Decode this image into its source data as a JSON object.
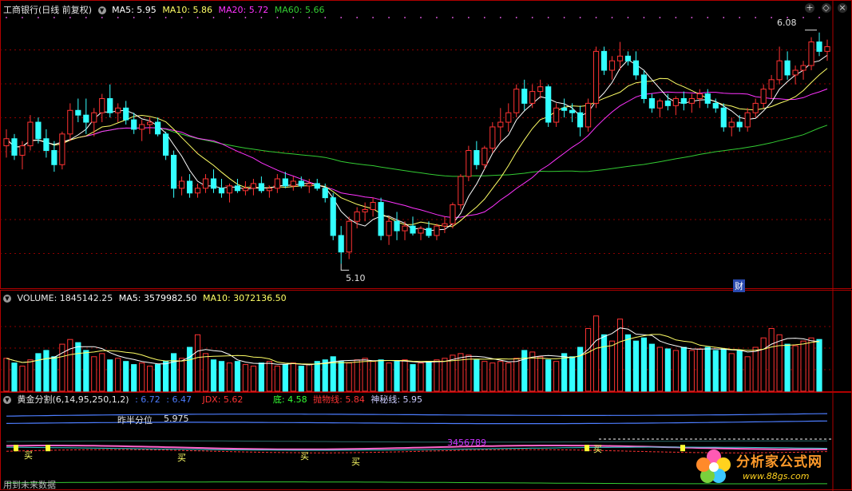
{
  "header": {
    "title": "工商银行(日线 前复权)",
    "ma5": "MA5: 5.95",
    "ma10": "MA10: 5.86",
    "ma20": "MA20: 5.72",
    "ma60": "MA60: 5.66"
  },
  "volume_header": {
    "title": "VOLUME: 1845142.25",
    "ma5": "MA5: 3579982.50",
    "ma10": "MA10: 3072136.50"
  },
  "indicator_header": {
    "title": "黄金分割(6,14,95,250,1,2)",
    "v1": ": 6.72",
    "v2": ": 6.47",
    "jdx": "JDX: 5.62",
    "di": "底: 4.58",
    "pwx": "抛物线: 5.84",
    "smx": "神秘线: 5.95"
  },
  "annotations": {
    "high": "6.08",
    "low": "5.10",
    "cai": "财",
    "half_label": "昨半分位",
    "half_value": "5.975",
    "buy": "买",
    "seq": "3456789",
    "future": "用到未来数据"
  },
  "window_buttons": {
    "add": "+",
    "restore": "◇",
    "close": "×"
  },
  "logo": {
    "text": "分析家公式网",
    "url": "www.88gs.com"
  },
  "colors": {
    "up": "#ff3333",
    "down": "#33ffff",
    "ma5": "#ffffff",
    "ma10": "#ffff66",
    "ma20": "#ff33ff",
    "ma60": "#33cc33",
    "grid": "#8b0000"
  },
  "chart_data": {
    "type": "candlestick",
    "price_ylim": [
      5.0,
      6.15
    ],
    "high_marker": 6.08,
    "low_marker": 5.1,
    "ohlc": [
      [
        5.6,
        5.67,
        5.55,
        5.63
      ],
      [
        5.63,
        5.65,
        5.54,
        5.56
      ],
      [
        5.56,
        5.62,
        5.5,
        5.6
      ],
      [
        5.6,
        5.73,
        5.58,
        5.7
      ],
      [
        5.7,
        5.72,
        5.61,
        5.63
      ],
      [
        5.63,
        5.67,
        5.55,
        5.58
      ],
      [
        5.58,
        5.62,
        5.49,
        5.52
      ],
      [
        5.52,
        5.66,
        5.5,
        5.65
      ],
      [
        5.65,
        5.78,
        5.62,
        5.75
      ],
      [
        5.75,
        5.8,
        5.7,
        5.73
      ],
      [
        5.73,
        5.8,
        5.65,
        5.7
      ],
      [
        5.7,
        5.76,
        5.64,
        5.74
      ],
      [
        5.74,
        5.82,
        5.7,
        5.8
      ],
      [
        5.8,
        5.86,
        5.72,
        5.74
      ],
      [
        5.74,
        5.78,
        5.7,
        5.76
      ],
      [
        5.76,
        5.79,
        5.69,
        5.71
      ],
      [
        5.71,
        5.74,
        5.65,
        5.67
      ],
      [
        5.67,
        5.71,
        5.62,
        5.69
      ],
      [
        5.69,
        5.72,
        5.65,
        5.7
      ],
      [
        5.7,
        5.72,
        5.64,
        5.65
      ],
      [
        5.65,
        5.66,
        5.54,
        5.56
      ],
      [
        5.56,
        5.58,
        5.38,
        5.42
      ],
      [
        5.42,
        5.47,
        5.39,
        5.45
      ],
      [
        5.45,
        5.48,
        5.38,
        5.4
      ],
      [
        5.4,
        5.44,
        5.38,
        5.42
      ],
      [
        5.42,
        5.48,
        5.4,
        5.46
      ],
      [
        5.46,
        5.5,
        5.4,
        5.42
      ],
      [
        5.42,
        5.46,
        5.38,
        5.4
      ],
      [
        5.4,
        5.44,
        5.36,
        5.43
      ],
      [
        5.43,
        5.46,
        5.4,
        5.41
      ],
      [
        5.41,
        5.45,
        5.39,
        5.42
      ],
      [
        5.42,
        5.46,
        5.39,
        5.44
      ],
      [
        5.44,
        5.47,
        5.4,
        5.41
      ],
      [
        5.41,
        5.43,
        5.38,
        5.42
      ],
      [
        5.42,
        5.48,
        5.4,
        5.46
      ],
      [
        5.46,
        5.49,
        5.42,
        5.43
      ],
      [
        5.43,
        5.47,
        5.41,
        5.45
      ],
      [
        5.45,
        5.47,
        5.42,
        5.43
      ],
      [
        5.43,
        5.46,
        5.4,
        5.44
      ],
      [
        5.44,
        5.46,
        5.41,
        5.42
      ],
      [
        5.42,
        5.44,
        5.36,
        5.38
      ],
      [
        5.38,
        5.4,
        5.2,
        5.22
      ],
      [
        5.22,
        5.26,
        5.1,
        5.15
      ],
      [
        5.15,
        5.3,
        5.12,
        5.28
      ],
      [
        5.28,
        5.34,
        5.25,
        5.32
      ],
      [
        5.32,
        5.36,
        5.28,
        5.33
      ],
      [
        5.33,
        5.38,
        5.3,
        5.36
      ],
      [
        5.36,
        5.38,
        5.2,
        5.22
      ],
      [
        5.22,
        5.3,
        5.18,
        5.28
      ],
      [
        5.28,
        5.32,
        5.2,
        5.24
      ],
      [
        5.24,
        5.28,
        5.2,
        5.26
      ],
      [
        5.26,
        5.3,
        5.22,
        5.23
      ],
      [
        5.23,
        5.26,
        5.2,
        5.25
      ],
      [
        5.25,
        5.28,
        5.21,
        5.22
      ],
      [
        5.22,
        5.27,
        5.2,
        5.26
      ],
      [
        5.26,
        5.3,
        5.23,
        5.27
      ],
      [
        5.27,
        5.36,
        5.25,
        5.35
      ],
      [
        5.35,
        5.48,
        5.33,
        5.47
      ],
      [
        5.47,
        5.6,
        5.45,
        5.58
      ],
      [
        5.58,
        5.62,
        5.5,
        5.52
      ],
      [
        5.52,
        5.6,
        5.5,
        5.59
      ],
      [
        5.59,
        5.7,
        5.57,
        5.68
      ],
      [
        5.68,
        5.76,
        5.62,
        5.7
      ],
      [
        5.7,
        5.78,
        5.66,
        5.74
      ],
      [
        5.74,
        5.86,
        5.72,
        5.84
      ],
      [
        5.84,
        5.88,
        5.75,
        5.78
      ],
      [
        5.78,
        5.86,
        5.76,
        5.83
      ],
      [
        5.83,
        5.88,
        5.8,
        5.85
      ],
      [
        5.85,
        5.86,
        5.68,
        5.7
      ],
      [
        5.7,
        5.78,
        5.68,
        5.76
      ],
      [
        5.76,
        5.8,
        5.72,
        5.75
      ],
      [
        5.75,
        5.78,
        5.7,
        5.74
      ],
      [
        5.74,
        5.77,
        5.64,
        5.68
      ],
      [
        5.68,
        5.8,
        5.66,
        5.78
      ],
      [
        5.78,
        6.02,
        5.76,
        6.0
      ],
      [
        6.0,
        6.02,
        5.9,
        5.92
      ],
      [
        5.92,
        5.98,
        5.88,
        5.96
      ],
      [
        5.96,
        6.04,
        5.92,
        5.98
      ],
      [
        5.98,
        6.0,
        5.94,
        5.96
      ],
      [
        5.96,
        6.0,
        5.88,
        5.9
      ],
      [
        5.9,
        5.92,
        5.78,
        5.8
      ],
      [
        5.8,
        5.82,
        5.74,
        5.76
      ],
      [
        5.76,
        5.8,
        5.72,
        5.79
      ],
      [
        5.79,
        5.82,
        5.75,
        5.77
      ],
      [
        5.77,
        5.81,
        5.73,
        5.8
      ],
      [
        5.8,
        5.83,
        5.75,
        5.78
      ],
      [
        5.78,
        5.82,
        5.74,
        5.8
      ],
      [
        5.8,
        5.84,
        5.76,
        5.82
      ],
      [
        5.82,
        5.84,
        5.76,
        5.78
      ],
      [
        5.78,
        5.8,
        5.74,
        5.76
      ],
      [
        5.76,
        5.78,
        5.66,
        5.68
      ],
      [
        5.68,
        5.72,
        5.64,
        5.7
      ],
      [
        5.7,
        5.73,
        5.66,
        5.68
      ],
      [
        5.68,
        5.76,
        5.66,
        5.74
      ],
      [
        5.74,
        5.8,
        5.72,
        5.78
      ],
      [
        5.78,
        5.86,
        5.76,
        5.84
      ],
      [
        5.84,
        5.9,
        5.8,
        5.88
      ],
      [
        5.88,
        6.02,
        5.86,
        5.96
      ],
      [
        5.96,
        6.0,
        5.88,
        5.9
      ],
      [
        5.9,
        5.94,
        5.86,
        5.92
      ],
      [
        5.92,
        5.96,
        5.88,
        5.94
      ],
      [
        5.94,
        6.06,
        5.92,
        6.04
      ],
      [
        6.04,
        6.08,
        5.98,
        6.0
      ],
      [
        6.0,
        6.05,
        5.96,
        6.02
      ]
    ],
    "volume": [
      2.1,
      1.8,
      1.6,
      2.0,
      2.4,
      2.6,
      2.2,
      3.0,
      3.3,
      3.1,
      2.6,
      2.2,
      2.4,
      2.0,
      2.1,
      1.9,
      1.7,
      1.8,
      1.6,
      1.7,
      1.9,
      2.4,
      2.1,
      2.8,
      3.6,
      2.4,
      2.0,
      1.9,
      1.8,
      1.9,
      1.7,
      1.6,
      1.8,
      1.9,
      1.6,
      1.7,
      1.8,
      1.6,
      1.7,
      1.9,
      2.0,
      2.2,
      1.9,
      1.8,
      2.0,
      2.1,
      1.9,
      2.0,
      1.8,
      1.9,
      2.0,
      1.7,
      1.8,
      1.9,
      2.0,
      2.1,
      2.3,
      2.4,
      2.3,
      2.0,
      1.9,
      1.8,
      1.9,
      1.8,
      2.1,
      2.6,
      2.5,
      2.2,
      2.0,
      1.9,
      2.4,
      2.2,
      2.8,
      4.0,
      4.8,
      3.6,
      3.2,
      4.6,
      3.6,
      3.2,
      3.4,
      3.0,
      2.8,
      2.7,
      2.6,
      2.8,
      2.6,
      2.7,
      2.8,
      2.6,
      2.7,
      2.4,
      2.6,
      2.2,
      2.8,
      3.4,
      4.0,
      3.6,
      3.0,
      2.9,
      3.2,
      3.4,
      3.3
    ],
    "volume_ylim": [
      0,
      5.5
    ],
    "indicator_ylim": [
      4.4,
      7.0
    ],
    "indicator_values": {
      "v1": 6.72,
      "v2": 6.47,
      "jdx": 5.62,
      "di": 4.58,
      "pwx": 5.84,
      "smx": 5.95,
      "half": 5.975
    }
  }
}
